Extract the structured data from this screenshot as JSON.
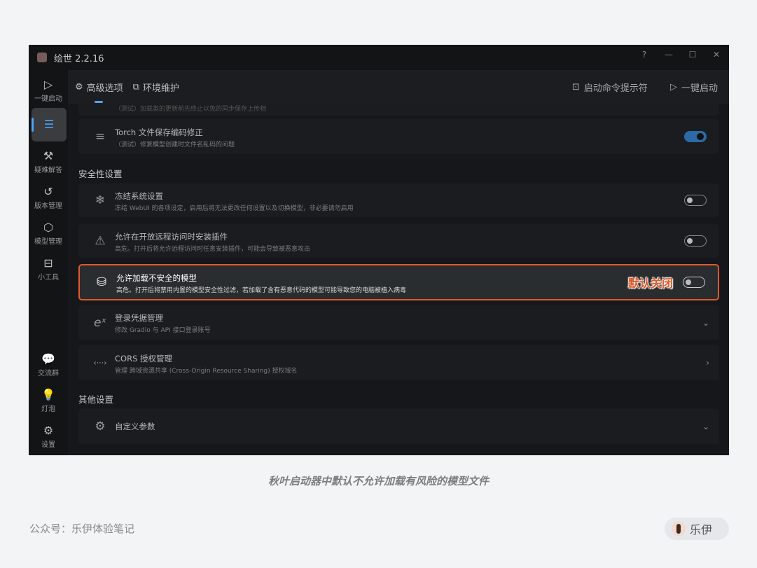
{
  "window": {
    "title": "绘世 2.2.16",
    "help": "?",
    "minimize": "—",
    "maximize": "☐",
    "close": "✕"
  },
  "sidebar": {
    "items": [
      {
        "label": "一键启动",
        "icon": "▷"
      },
      {
        "label": "",
        "icon": "☰"
      },
      {
        "label": "疑难解答",
        "icon": "⚒"
      },
      {
        "label": "版本管理",
        "icon": "↺"
      },
      {
        "label": "模型管理",
        "icon": "⬡"
      },
      {
        "label": "小工具",
        "icon": "⊟"
      }
    ],
    "bottom": [
      {
        "label": "交流群",
        "icon": "💬"
      },
      {
        "label": "灯泡",
        "icon": "💡"
      },
      {
        "label": "设置",
        "icon": "⚙"
      }
    ]
  },
  "header": {
    "tabs": [
      {
        "label": "高级选项",
        "icon": "⚙"
      },
      {
        "label": "环境维护",
        "icon": "⧉"
      }
    ],
    "cmd_label": "启动命令提示符",
    "cmd_icon": "⊡",
    "launch_label": "一键启动",
    "launch_icon": "▷"
  },
  "cards": {
    "partial": {
      "desc": "（测试）加载类的更新前先终止以免的同步保存上传相"
    },
    "torch": {
      "title": "Torch 文件保存编码修正",
      "desc": "（测试）修复模型创建时文件名乱码的问题",
      "icon": "≡",
      "on": true
    },
    "freeze": {
      "title": "冻结系统设置",
      "desc": "冻结 WebUI 的各项设定，启用后将无法更改任何设置以及切换模型，非必要请勿启用",
      "icon": "❄",
      "on": false
    },
    "remote": {
      "title": "允许在开放远程访问时安装插件",
      "desc": "高危。打开后将允许远程访问时任意安装插件，可能会导致被恶意攻击",
      "icon": "⚠",
      "on": false
    },
    "unsafe": {
      "title": "允许加载不安全的模型",
      "desc": "高危。打开后将禁用内置的模型安全性过滤，若加载了含有恶意代码的模型可能导致您的电脑被植入病毒",
      "icon": "⛁",
      "on": false,
      "note": "默认关闭"
    },
    "login": {
      "title": "登录凭据管理",
      "desc": "修改 Gradio 与 API 接口登录账号",
      "icon": "eˣ",
      "chevron": "⌄"
    },
    "cors": {
      "title": "CORS 授权管理",
      "desc": "管理 跨域资源共享 (Cross-Origin Resource Sharing) 授权域名",
      "icon": "‹···›",
      "chevron": "›"
    },
    "custom": {
      "title": "自定义参数",
      "icon": "⚙",
      "chevron": "⌄"
    }
  },
  "sections": {
    "security": "安全性设置",
    "other": "其他设置"
  },
  "caption": "秋叶启动器中默认不允许加载有风险的模型文件",
  "footer": {
    "account": "公众号：乐伊体验笔记",
    "author": "乐伊"
  },
  "colors": {
    "accent": "#4ea3f5",
    "highlight": "#e0592a",
    "toggle_on": "#2c6aa5"
  }
}
